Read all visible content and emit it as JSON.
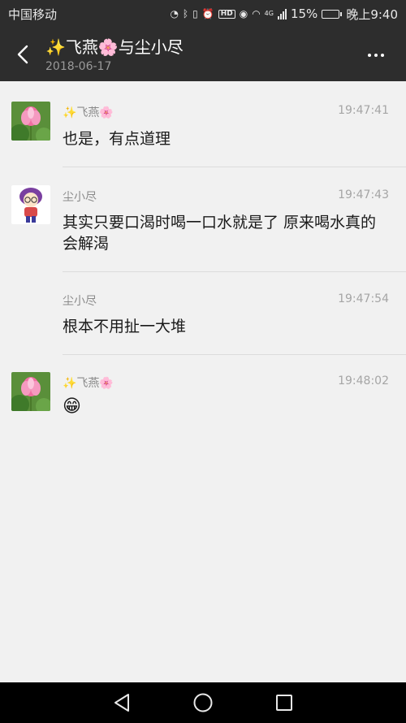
{
  "status_bar": {
    "carrier": "中国移动",
    "network": "4G",
    "battery": "15%",
    "battery_level": 0.15,
    "time": "晚上9:40"
  },
  "header": {
    "title": "✨飞燕🌸与尘小尽",
    "date": "2018-06-17"
  },
  "messages": [
    {
      "sender": "✨飞燕🌸",
      "time": "19:47:41",
      "text": "也是，有点道理"
    },
    {
      "sender": "尘小尽",
      "time": "19:47:43",
      "text": "其实只要口渴时喝一口水就是了 原来喝水真的会解渴"
    },
    {
      "sender": "尘小尽",
      "time": "19:47:54",
      "text": "根本不用扯一大堆"
    },
    {
      "sender": "✨飞燕🌸",
      "time": "19:48:02",
      "text": "😁"
    }
  ]
}
